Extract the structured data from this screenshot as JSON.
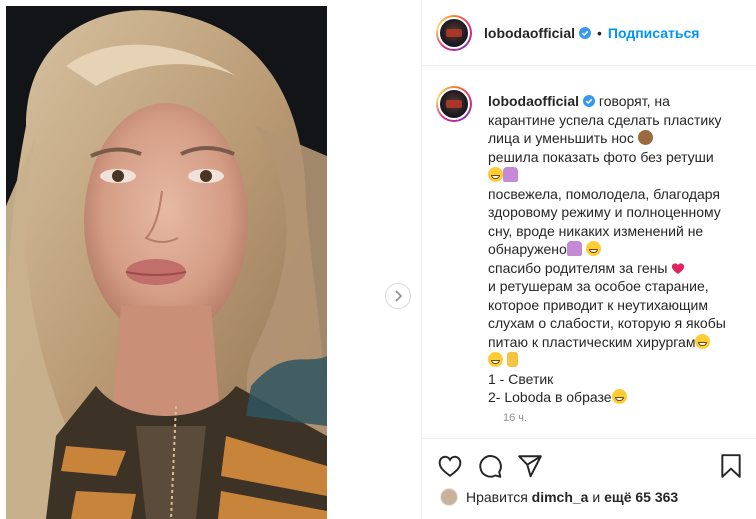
{
  "post": {
    "username": "lobodaofficial",
    "follow_label": "Подписаться",
    "dot": "•",
    "caption_lines": [
      "говорят, на",
      "карантине успела сделать пластику",
      "лица и уменьшить нос",
      "решила показать фото без ретуши",
      "",
      "посвежела, помолодела, благодаря",
      "здоровому режиму и полноценному",
      "сну, вроде никаких изменений не",
      "обнаружено",
      "спасибо родителям за гены",
      "и ретушерам за особое старание,",
      "которое приводит к неутихающим",
      "слухам о слабости, которую я якобы",
      "питаю к пластическим хирургам",
      "",
      "1 - Светик",
      "2- Loboda в образе"
    ],
    "time": "16 ч.",
    "likes_prefix": "Нравится",
    "likes_user": "dimch_a",
    "likes_mid": "и",
    "likes_count": "ещё 65 363"
  },
  "icons": [
    "verified-icon",
    "heart-icon",
    "comment-icon",
    "share-icon",
    "bookmark-icon",
    "chevron-right-icon"
  ],
  "colors": {
    "accent": "#0095f6",
    "verified": "#3897f0",
    "text": "#262626",
    "muted": "#8e8e8e",
    "border": "#efefef"
  }
}
